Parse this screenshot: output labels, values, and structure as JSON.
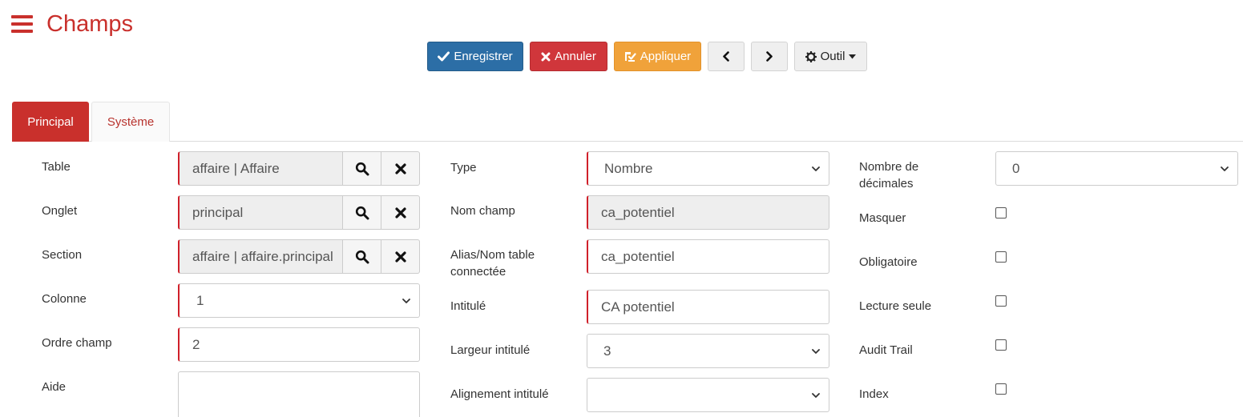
{
  "header": {
    "title": "Champs"
  },
  "toolbar": {
    "save_label": "Enregistrer",
    "cancel_label": "Annuler",
    "apply_label": "Appliquer",
    "tool_label": "Outil"
  },
  "tabs": [
    {
      "label": "Principal",
      "active": true
    },
    {
      "label": "Système",
      "active": false
    }
  ],
  "form": {
    "table": {
      "label": "Table",
      "value": "affaire | Affaire"
    },
    "onglet": {
      "label": "Onglet",
      "value": "principal"
    },
    "section": {
      "label": "Section",
      "value": "affaire | affaire.principal"
    },
    "colonne": {
      "label": "Colonne",
      "value": "1"
    },
    "ordre_champ": {
      "label": "Ordre champ",
      "value": "2"
    },
    "aide": {
      "label": "Aide",
      "value": ""
    },
    "type": {
      "label": "Type",
      "value": "Nombre"
    },
    "nom_champ": {
      "label": "Nom champ",
      "value": "ca_potentiel"
    },
    "alias": {
      "label_line1": "Alias/Nom table",
      "label_line2": "connectée",
      "value": "ca_potentiel"
    },
    "intitule": {
      "label": "Intitulé",
      "value": "CA potentiel"
    },
    "largeur_intitule": {
      "label": "Largeur intitulé",
      "value": "3"
    },
    "alignement_intitule": {
      "label": "Alignement intitulé",
      "value": ""
    },
    "nombre_decimales": {
      "label_line1": "Nombre de",
      "label_line2": "décimales",
      "value": "0"
    },
    "masquer": {
      "label": "Masquer",
      "checked": false
    },
    "obligatoire": {
      "label": "Obligatoire",
      "checked": false
    },
    "lecture_seule": {
      "label": "Lecture seule",
      "checked": false
    },
    "audit_trail": {
      "label": "Audit Trail",
      "checked": false
    },
    "index": {
      "label": "Index",
      "checked": false
    }
  },
  "colors": {
    "accent": "#c9302c",
    "primary": "#2c6ea6",
    "danger": "#d0363b",
    "warning": "#f0a23a",
    "required_marker": "#d0202a"
  },
  "icons": {
    "menu": "hamburger-icon",
    "save": "check-icon",
    "cancel": "times-icon",
    "apply": "apply-icon",
    "prev": "chevron-left-icon",
    "next": "chevron-right-icon",
    "tool": "gear-icon",
    "search": "search-icon",
    "clear": "times-icon",
    "select": "chevron-down-icon"
  }
}
